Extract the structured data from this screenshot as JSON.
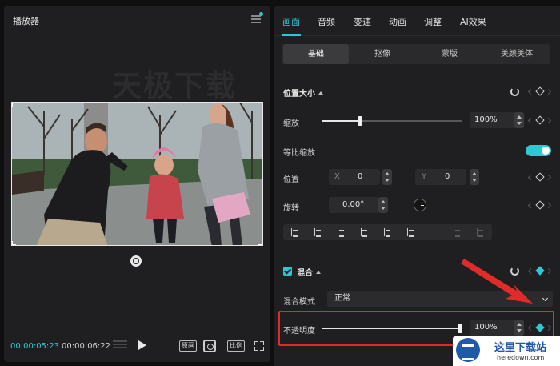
{
  "player": {
    "title": "播放器",
    "watermark": "天极下载",
    "current_time": "00:00:05:23",
    "total_time": "00:00:06:22",
    "btn_original": "原画",
    "btn_ratio": "比例"
  },
  "tabs": [
    {
      "label": "画面"
    },
    {
      "label": "音频"
    },
    {
      "label": "变速"
    },
    {
      "label": "动画"
    },
    {
      "label": "调整"
    },
    {
      "label": "AI效果"
    }
  ],
  "subtabs": [
    {
      "label": "基础"
    },
    {
      "label": "抠像"
    },
    {
      "label": "蒙版"
    },
    {
      "label": "美颜美体"
    }
  ],
  "position_size": {
    "title": "位置大小",
    "scale_label": "缩放",
    "scale_value": "100%",
    "scale_fraction": 0.27,
    "uniform_scale_label": "等比缩放",
    "uniform_scale_on": true,
    "position_label": "位置",
    "x_label": "X",
    "x_value": "0",
    "y_label": "Y",
    "y_value": "0",
    "rotate_label": "旋转",
    "rotate_value": "0.00°"
  },
  "blend": {
    "title": "混合",
    "enabled": true,
    "mode_label": "混合模式",
    "mode_value": "正常",
    "opacity_label": "不透明度",
    "opacity_value": "100%",
    "opacity_fraction": 1.0
  },
  "site_logo": {
    "text": "这里下载站",
    "url": "heredown.com"
  },
  "colors": {
    "accent": "#2ec7d4",
    "highlight": "#e02b2b",
    "panel": "#1f1f21"
  }
}
